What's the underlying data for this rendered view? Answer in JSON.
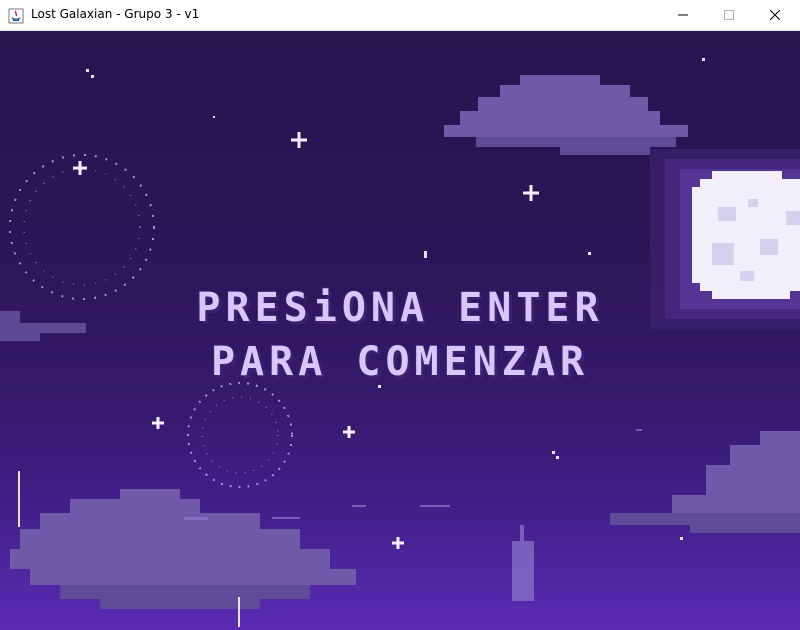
{
  "window": {
    "title": "Lost Galaxian - Grupo 3 - v1",
    "icon": "java-app-icon",
    "controls": [
      "minimize",
      "maximize",
      "close"
    ]
  },
  "game": {
    "prompt_line1": "PRESiONA ENTER",
    "prompt_line2": "PARA COMENZAR"
  },
  "colors": {
    "sky_top": "#2a1450",
    "sky_bottom": "#5a2cb4",
    "text": "#d9c6ff",
    "cloud": "#6e5aa8",
    "moon": "#f2eefc"
  }
}
